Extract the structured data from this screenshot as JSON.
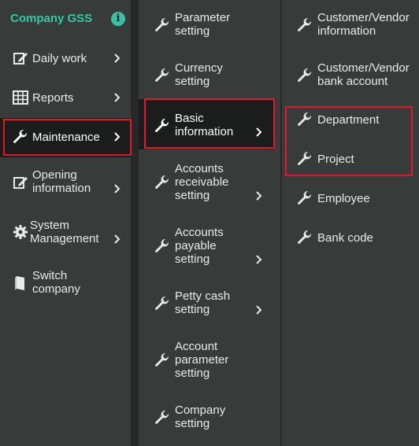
{
  "sidebar": {
    "brand": "Company GSS",
    "info_icon": "info-icon",
    "items": [
      {
        "label": "Daily work",
        "icon": "edit-icon",
        "has_submenu": true
      },
      {
        "label": "Reports",
        "icon": "table-icon",
        "has_submenu": true
      },
      {
        "label": "Maintenance",
        "icon": "wrench-icon",
        "has_submenu": true,
        "active": true
      },
      {
        "label": "Opening information",
        "icon": "edit-icon",
        "has_submenu": true
      },
      {
        "label": "System Management",
        "icon": "gear-icon",
        "has_submenu": true
      },
      {
        "label": "Switch company",
        "icon": "book-icon",
        "has_submenu": false
      }
    ]
  },
  "submenu": {
    "items": [
      {
        "label": "Parameter setting",
        "icon": "wrench-icon",
        "has_submenu": false
      },
      {
        "label": "Currency setting",
        "icon": "wrench-icon",
        "has_submenu": false
      },
      {
        "label": "Basic information",
        "icon": "wrench-icon",
        "has_submenu": true,
        "active": true
      },
      {
        "label": "Accounts receivable setting",
        "icon": "wrench-icon",
        "has_submenu": true
      },
      {
        "label": "Accounts payable setting",
        "icon": "wrench-icon",
        "has_submenu": true
      },
      {
        "label": "Petty cash setting",
        "icon": "wrench-icon",
        "has_submenu": true
      },
      {
        "label": "Account parameter setting",
        "icon": "wrench-icon",
        "has_submenu": false
      },
      {
        "label": "Company setting",
        "icon": "wrench-icon",
        "has_submenu": false
      }
    ]
  },
  "basic_information": {
    "items": [
      {
        "label": "Customer/Vendor information",
        "icon": "wrench-icon"
      },
      {
        "label": "Customer/Vendor bank account",
        "icon": "wrench-icon"
      },
      {
        "label": "Department",
        "icon": "wrench-icon",
        "highlighted": true
      },
      {
        "label": "Project",
        "icon": "wrench-icon",
        "highlighted": true
      },
      {
        "label": "Employee",
        "icon": "wrench-icon"
      },
      {
        "label": "Bank code",
        "icon": "wrench-icon"
      }
    ]
  },
  "colors": {
    "brand": "#35c8a8",
    "highlight_border": "#e3162a",
    "active_background": "#1b1d1c",
    "menu_background": "#373b39"
  }
}
